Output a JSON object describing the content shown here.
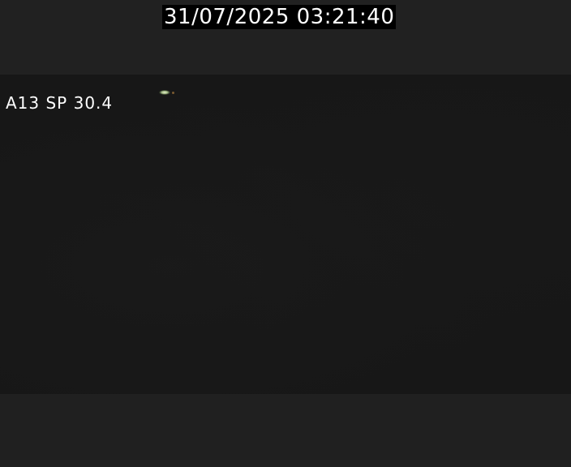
{
  "overlay": {
    "timestamp": "31/07/2025 03:21:40",
    "camera_label": "A13 SP 30.4"
  },
  "colors": {
    "background": "#202020",
    "scene": "#171717",
    "timestamp_bg": "#000000",
    "text": "#ffffff"
  }
}
